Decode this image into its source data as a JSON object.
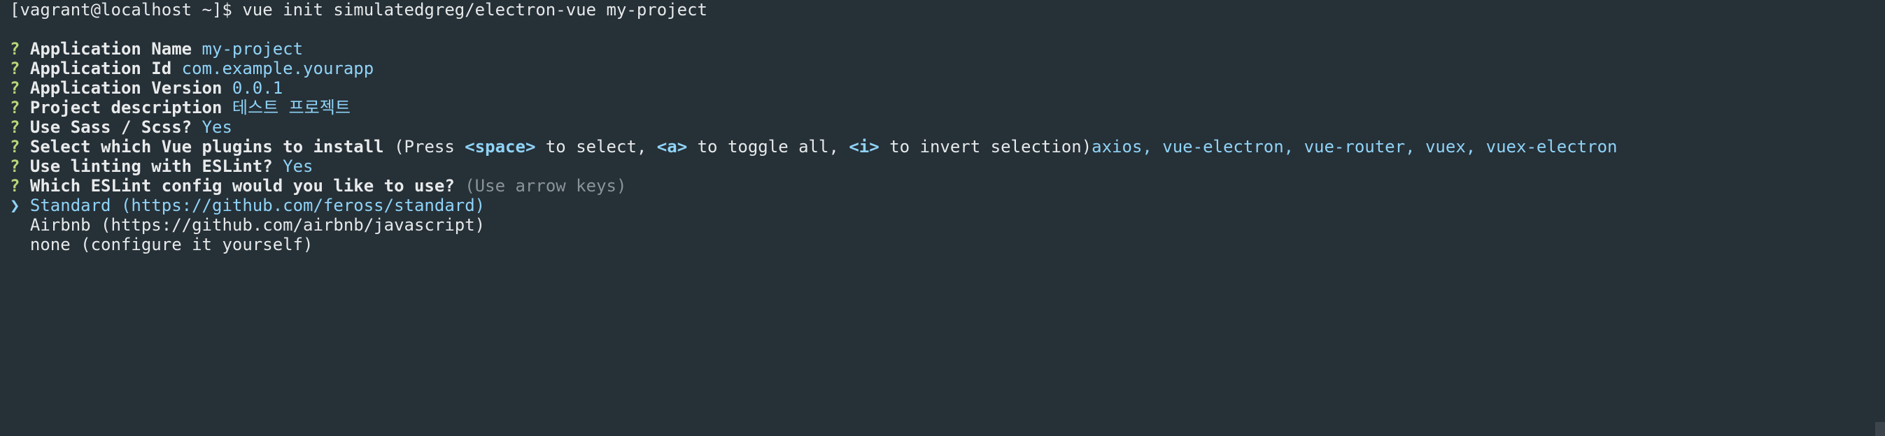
{
  "terminal": {
    "prompt": "[vagrant@localhost ~]$ vue init simulatedgreg/electron-vue my-project",
    "qmark": "?",
    "answers": [
      {
        "label": "Application Name",
        "value": "my-project"
      },
      {
        "label": "Application Id",
        "value": "com.example.yourapp"
      },
      {
        "label": "Application Version",
        "value": "0.0.1"
      },
      {
        "label": "Project description",
        "value": "테스트 프로젝트"
      },
      {
        "label": "Use Sass / Scss?",
        "value": "Yes"
      }
    ],
    "plugins": {
      "label": "Select which Vue plugins to install",
      "hint_open": "(Press ",
      "key_space": "<space>",
      "hint_mid1": " to select, ",
      "key_a": "<a>",
      "hint_mid2": " to toggle all, ",
      "key_i": "<i>",
      "hint_close": " to invert selection)",
      "value": "axios, vue-electron, vue-router, vuex, vuex-electron"
    },
    "linting": {
      "label": "Use linting with ESLint?",
      "value": "Yes"
    },
    "eslint_question": {
      "label": "Which ESLint config would you like to use?",
      "hint": "(Use arrow keys)"
    },
    "pointer": "❯",
    "options": [
      "Standard (https://github.com/feross/standard)",
      "Airbnb (https://github.com/airbnb/javascript)",
      "none (configure it yourself)"
    ]
  },
  "colors": {
    "background": "#263037",
    "question_mark": "#b7d778",
    "answer": "#8fd3f7",
    "dim": "#8a9398"
  }
}
